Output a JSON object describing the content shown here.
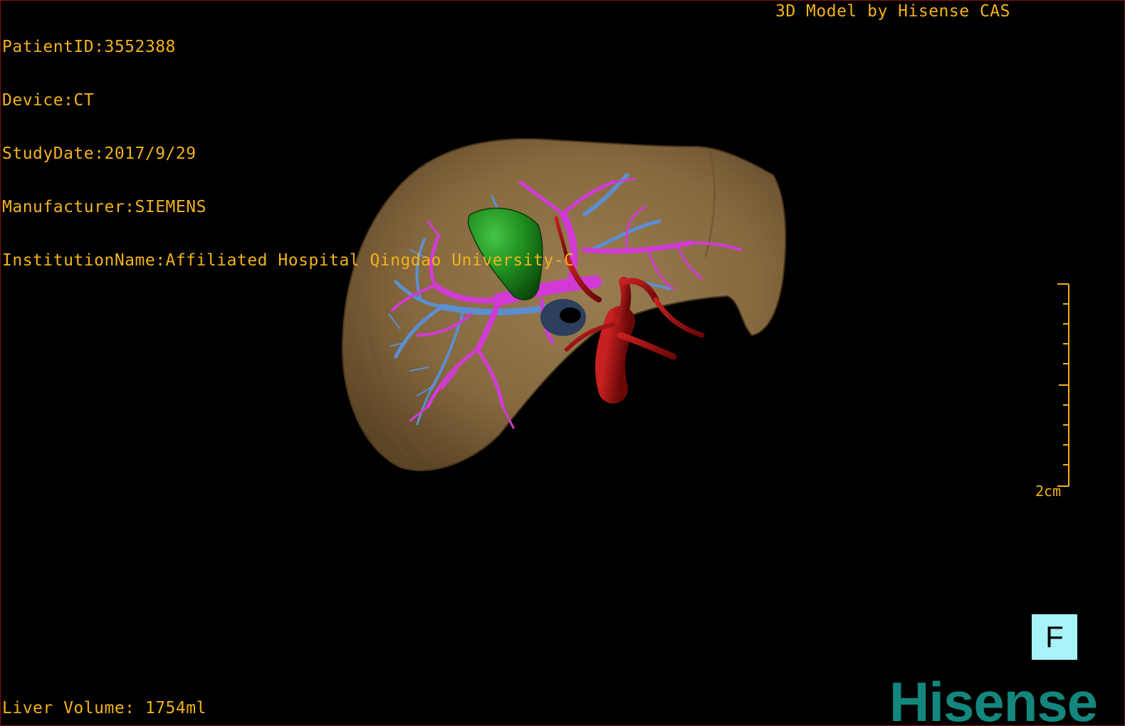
{
  "patient_info": {
    "patient_id": "PatientID:3552388",
    "device": "Device:CT",
    "study_date": "StudyDate:2017/9/29",
    "manufacturer": "Manufacturer:SIEMENS",
    "institution": "InstitutionName:Affiliated Hospital Qingdao University-C"
  },
  "model_credit": "3D Model by Hisense CAS",
  "liver_volume": "Liver Volume: 1754ml",
  "scale": {
    "label": "2cm"
  },
  "orientation": {
    "label": "F"
  },
  "brand": {
    "name": "Hisense",
    "color": "#13877d"
  },
  "colors": {
    "text": "#f2b21a",
    "liver": "#8a7048",
    "portal_vein": "#d23ad6",
    "hepatic_vein": "#5b8fd0",
    "artery": "#a01414",
    "tumor": "#1c8a1c",
    "orientation_box": "#a6f3f8"
  }
}
